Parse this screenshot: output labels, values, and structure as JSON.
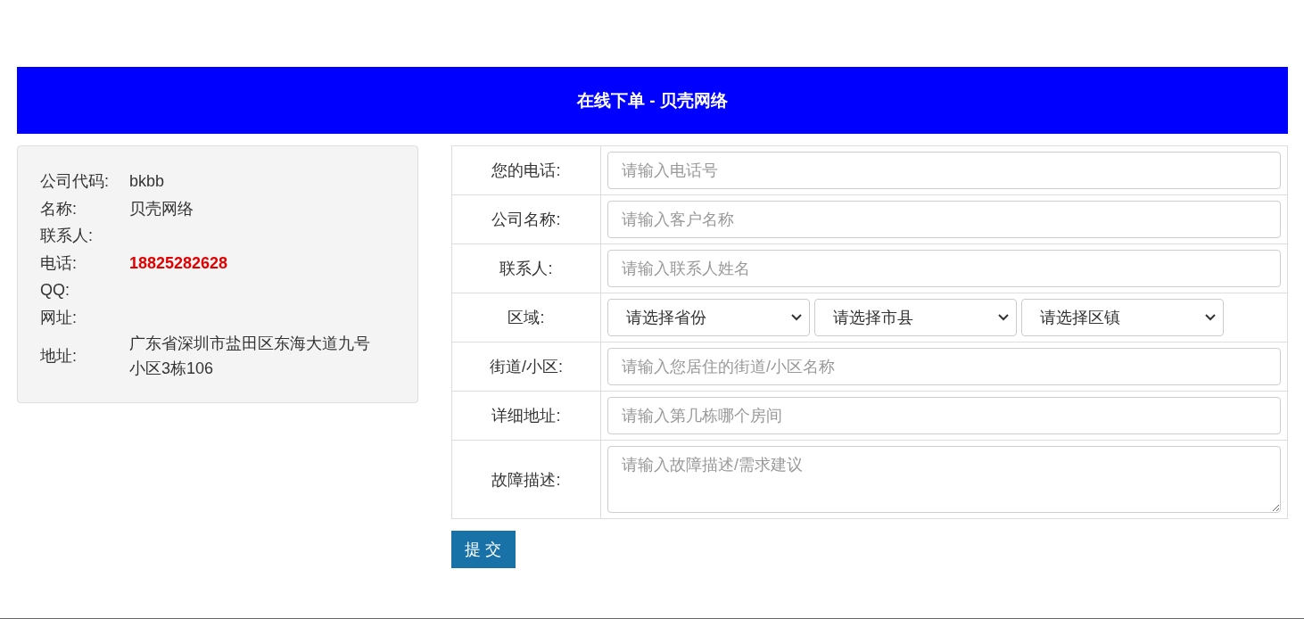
{
  "header": {
    "title": "在线下单 - 贝壳网络"
  },
  "company_info": [
    {
      "label": "公司代码:",
      "value": "bkbb",
      "kind": "text"
    },
    {
      "label": "名称:",
      "value": "贝壳网络",
      "kind": "text"
    },
    {
      "label": "联系人:",
      "kind": "text"
    },
    {
      "label": "电话:",
      "value": "18825282628",
      "kind": "phone"
    },
    {
      "label": "QQ:",
      "kind": "text"
    },
    {
      "label": "网址:",
      "kind": "text"
    },
    {
      "label": "地址:",
      "value": "广东省深圳市盐田区东海大道九号小区3栋106",
      "kind": "text"
    }
  ],
  "form": [
    {
      "label": "您的电话:",
      "kind": "input",
      "placeholder": "请输入电话号"
    },
    {
      "label": "公司名称:",
      "kind": "input",
      "placeholder": "请输入客户名称"
    },
    {
      "label": "联系人:",
      "kind": "input",
      "placeholder": "请输入联系人姓名"
    },
    {
      "label": "区域:",
      "kind": "select",
      "selects": [
        "请选择省份",
        "请选择市县",
        "请选择区镇"
      ]
    },
    {
      "label": "街道/小区:",
      "kind": "input",
      "placeholder": "请输入您居住的街道/小区名称"
    },
    {
      "label": "详细地址:",
      "kind": "input",
      "placeholder": "请输入第几栋哪个房间"
    },
    {
      "label": "故障描述:",
      "kind": "textarea",
      "placeholder": "请输入故障描述/需求建议"
    }
  ],
  "submit_button": "提 交"
}
